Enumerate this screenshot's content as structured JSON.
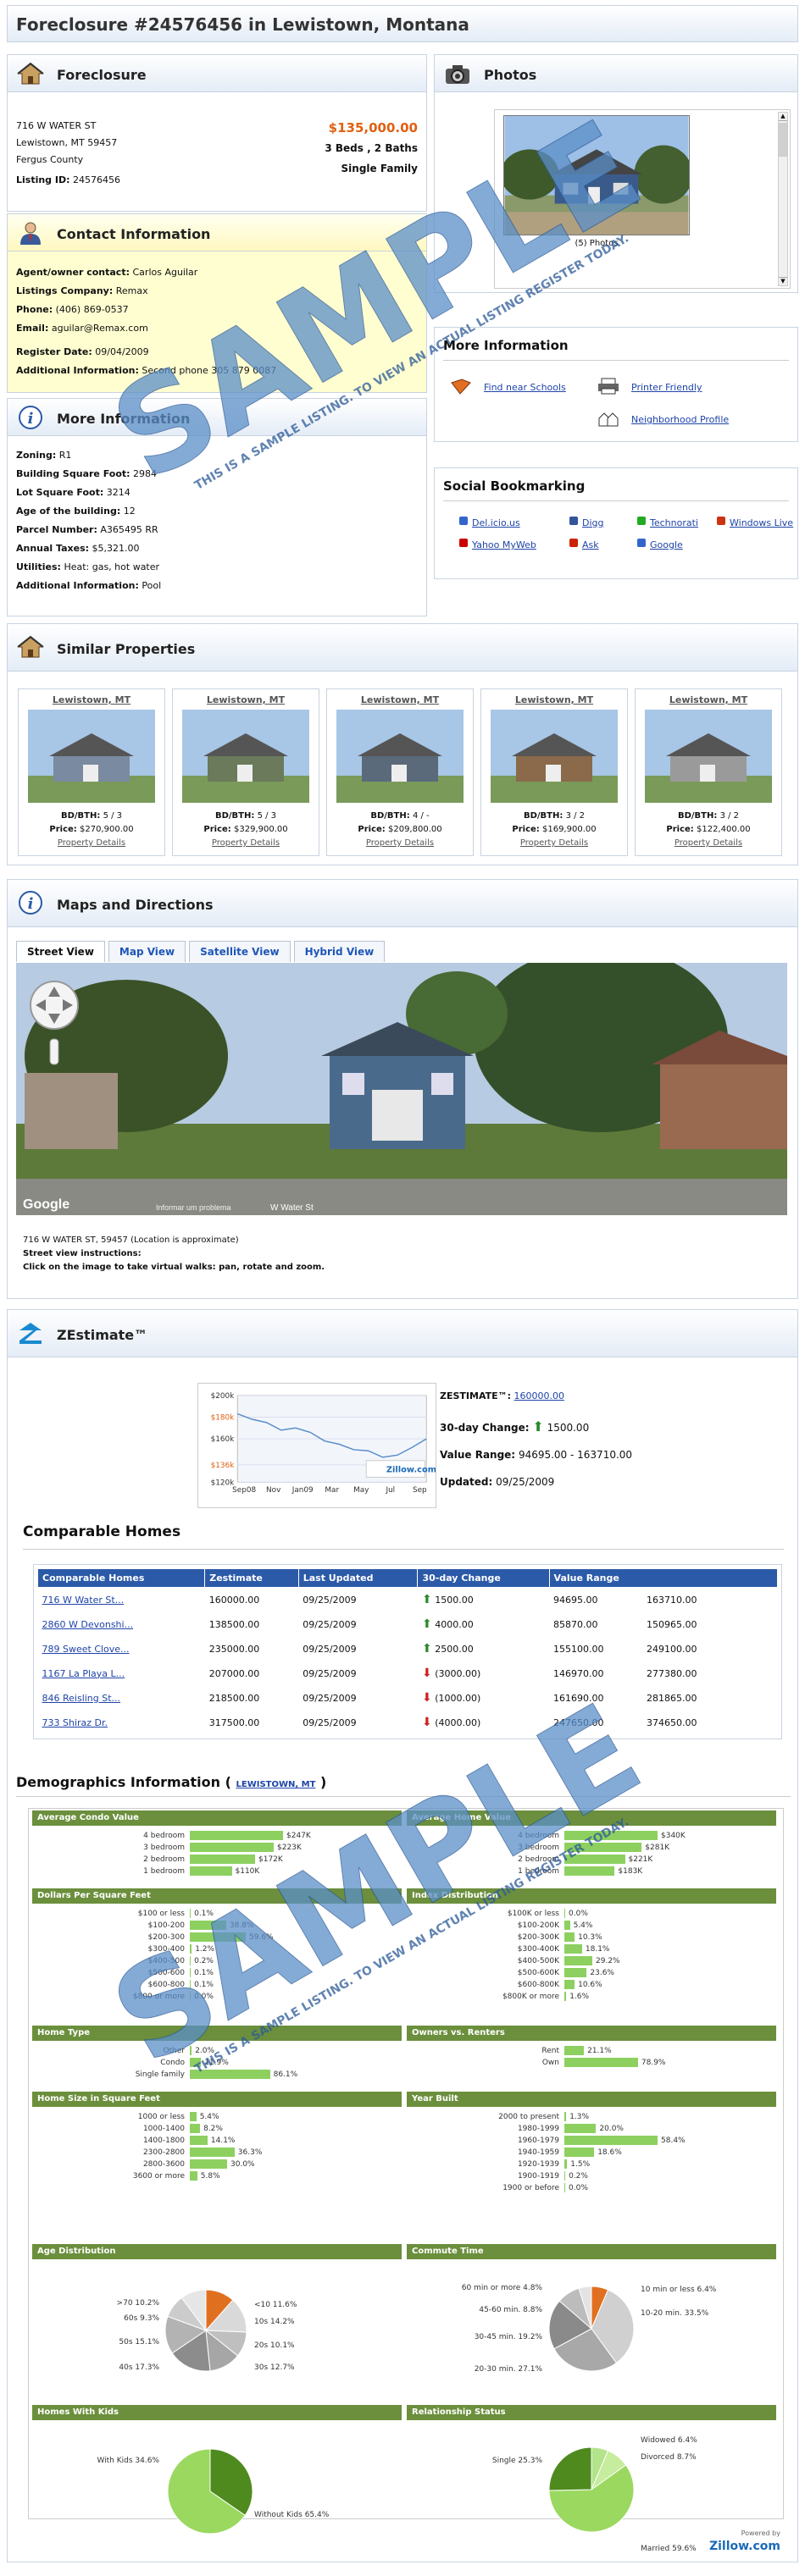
{
  "page_title": "Foreclosure #24576456 in Lewistown, Montana",
  "foreclosure": {
    "heading": "Foreclosure",
    "address1": "716 W WATER ST",
    "address2": "Lewistown, MT 59457",
    "county": "Fergus County",
    "listing_label": "Listing ID:",
    "listing_id": "24576456",
    "price": "$135,000.00",
    "beds": "3 Beds , 2 Baths",
    "type": "Single Family"
  },
  "contact": {
    "heading": "Contact Information",
    "rows": [
      {
        "k": "Agent/owner contact:",
        "v": "Carlos Aguilar"
      },
      {
        "k": "Listings Company:",
        "v": "Remax"
      },
      {
        "k": "Phone:",
        "v": "(406) 869-0537"
      },
      {
        "k": "Email:",
        "v": "aguilar@Remax.com"
      },
      {
        "k": "Register Date:",
        "v": "09/04/2009"
      },
      {
        "k": "Additional Information:",
        "v": "Second phone 305 879 0087"
      }
    ]
  },
  "more_info_left": {
    "heading": "More Information",
    "rows": [
      {
        "k": "Zoning:",
        "v": "R1"
      },
      {
        "k": "Building Square Foot:",
        "v": "2984"
      },
      {
        "k": "Lot Square Foot:",
        "v": "3214"
      },
      {
        "k": "Age of the building:",
        "v": "12"
      },
      {
        "k": "Parcel Number:",
        "v": "A365495 RR"
      },
      {
        "k": "Annual Taxes:",
        "v": "$5,321.00"
      },
      {
        "k": "Utilities:",
        "v": "Heat: gas, hot water"
      },
      {
        "k": "Additional Information:",
        "v": "Pool"
      }
    ]
  },
  "photos": {
    "heading": "Photos",
    "caption": "(5) Photos"
  },
  "more_info_right": {
    "heading": "More Information",
    "find_schools": "Find near Schools",
    "printer": "Printer Friendly",
    "neighborhood": "Neighborhood Profile"
  },
  "social": {
    "heading": "Social Bookmarking",
    "items": [
      "Del.icio.us",
      "Digg",
      "Technorati",
      "Windows Live",
      "Yahoo MyWeb",
      "Ask",
      "Google"
    ]
  },
  "similar": {
    "heading": "Similar Properties",
    "items": [
      {
        "city": "Lewistown, MT",
        "bdbth": "5 / 3",
        "price": "$270,900.00",
        "link": "Property Details"
      },
      {
        "city": "Lewistown, MT",
        "bdbth": "5 / 3",
        "price": "$329,900.00",
        "link": "Property Details"
      },
      {
        "city": "Lewistown, MT",
        "bdbth": "4 / -",
        "price": "$209,800.00",
        "link": "Property Details"
      },
      {
        "city": "Lewistown, MT",
        "bdbth": "3 / 2",
        "price": "$169,900.00",
        "link": "Property Details"
      },
      {
        "city": "Lewistown, MT",
        "bdbth": "3 / 2",
        "price": "$122,400.00",
        "link": "Property Details"
      }
    ],
    "bd_label": "BD/BTH:",
    "price_label": "Price:"
  },
  "maps": {
    "heading": "Maps and Directions",
    "tabs": [
      "Street View",
      "Map View",
      "Satellite View",
      "Hybrid View"
    ],
    "address": "716 W WATER ST, 59457 (Location is approximate)",
    "instr_title": "Street view instructions:",
    "instr": "Click on the image to take virtual walks: pan, rotate and zoom.",
    "google": "Google",
    "terms": "Informar um problema",
    "street": "W Water St"
  },
  "zestimate": {
    "heading": "ZEstimate™",
    "label": "ZESTIMATE™:",
    "value": "160000.00",
    "change_label": "30-day Change:",
    "change": "1500.00",
    "range_label": "Value Range:",
    "range": "94695.00 - 163710.00",
    "updated_label": "Updated:",
    "updated": "09/25/2009",
    "zillow": "Zillow.com"
  },
  "chart_data": {
    "type": "line",
    "x": [
      "Sep08",
      "Nov",
      "Jan09",
      "Mar",
      "May",
      "Jul",
      "Sep"
    ],
    "yticks": [
      "$200k",
      "$180k",
      "$160k",
      "$136k",
      "$120k"
    ],
    "ylim": [
      120000,
      200000
    ],
    "values": [
      183000,
      178000,
      175000,
      168000,
      170000,
      166000,
      158000,
      155000,
      150000,
      149000,
      143000,
      145000,
      152000,
      160000
    ]
  },
  "comparable": {
    "heading": "Comparable Homes",
    "cols": [
      "Comparable Homes",
      "Zestimate",
      "Last Updated",
      "30-day Change",
      "Value Range"
    ],
    "rows": [
      {
        "name": "716 W Water St...",
        "z": "160000.00",
        "u": "09/25/2009",
        "dir": "up",
        "c": "1500.00",
        "lo": "94695.00",
        "hi": "163710.00"
      },
      {
        "name": "2860 W Devonshi...",
        "z": "138500.00",
        "u": "09/25/2009",
        "dir": "up",
        "c": "4000.00",
        "lo": "85870.00",
        "hi": "150965.00"
      },
      {
        "name": "789 Sweet Clove...",
        "z": "235000.00",
        "u": "09/25/2009",
        "dir": "up",
        "c": "2500.00",
        "lo": "155100.00",
        "hi": "249100.00"
      },
      {
        "name": "1167 La Playa L...",
        "z": "207000.00",
        "u": "09/25/2009",
        "dir": "down",
        "c": "(3000.00)",
        "lo": "146970.00",
        "hi": "277380.00"
      },
      {
        "name": "846 Reisling St...",
        "z": "218500.00",
        "u": "09/25/2009",
        "dir": "down",
        "c": "(1000.00)",
        "lo": "161690.00",
        "hi": "281865.00"
      },
      {
        "name": "733 Shiraz Dr.",
        "z": "317500.00",
        "u": "09/25/2009",
        "dir": "down",
        "c": "(4000.00)",
        "lo": "247650.00",
        "hi": "374650.00"
      }
    ]
  },
  "demographics": {
    "heading": "Demographics Information (",
    "link": "LEWISTOWN, MT",
    "close": ")",
    "avg_condo": {
      "title": "Average Condo Value",
      "rows": [
        {
          "l": "4 bedroom",
          "v": "$247K",
          "f": 1.0
        },
        {
          "l": "3 bedroom",
          "v": "$223K",
          "f": 0.9
        },
        {
          "l": "2 bedroom",
          "v": "$172K",
          "f": 0.7
        },
        {
          "l": "1 bedroom",
          "v": "$110K",
          "f": 0.45
        }
      ]
    },
    "avg_home": {
      "title": "Average Home Value",
      "rows": [
        {
          "l": "4 bedroom",
          "v": "$340K",
          "f": 1.0
        },
        {
          "l": "3 bedroom",
          "v": "$281K",
          "f": 0.83
        },
        {
          "l": "2 bedroom",
          "v": "$221K",
          "f": 0.65
        },
        {
          "l": "1 bedroom",
          "v": "$183K",
          "f": 0.54
        }
      ]
    },
    "dpsf": {
      "title": "Dollars Per Square Feet",
      "rows": [
        {
          "l": "$100 or less",
          "v": "0.1%",
          "f": 0.01
        },
        {
          "l": "$100-200",
          "v": "38.8%",
          "f": 0.39
        },
        {
          "l": "$200-300",
          "v": "59.6%",
          "f": 0.6
        },
        {
          "l": "$300-400",
          "v": "1.2%",
          "f": 0.02
        },
        {
          "l": "$400-500",
          "v": "0.2%",
          "f": 0.01
        },
        {
          "l": "$500-600",
          "v": "0.1%",
          "f": 0.01
        },
        {
          "l": "$600-800",
          "v": "0.1%",
          "f": 0.01
        },
        {
          "l": "$800 or more",
          "v": "0.0%",
          "f": 0
        }
      ]
    },
    "index": {
      "title": "Index Distribution",
      "rows": [
        {
          "l": "$100K or less",
          "v": "0.0%",
          "f": 0
        },
        {
          "l": "$100-200K",
          "v": "5.4%",
          "f": 0.06
        },
        {
          "l": "$200-300K",
          "v": "10.3%",
          "f": 0.11
        },
        {
          "l": "$300-400K",
          "v": "18.1%",
          "f": 0.19
        },
        {
          "l": "$400-500K",
          "v": "29.2%",
          "f": 0.3
        },
        {
          "l": "$500-600K",
          "v": "23.6%",
          "f": 0.24
        },
        {
          "l": "$600-800K",
          "v": "10.6%",
          "f": 0.11
        },
        {
          "l": "$800K or more",
          "v": "1.6%",
          "f": 0.02
        }
      ]
    },
    "hometype": {
      "title": "Home Type",
      "rows": [
        {
          "l": "Other",
          "v": "2.0%",
          "f": 0.02
        },
        {
          "l": "Condo",
          "v": "11.9%",
          "f": 0.12
        },
        {
          "l": "Single family",
          "v": "86.1%",
          "f": 0.86
        }
      ]
    },
    "owners": {
      "title": "Owners vs. Renters",
      "rows": [
        {
          "l": "Rent",
          "v": "21.1%",
          "f": 0.21
        },
        {
          "l": "Own",
          "v": "78.9%",
          "f": 0.79
        }
      ]
    },
    "homesize": {
      "title": "Home Size in Square Feet",
      "rows": [
        {
          "l": "1000 or less",
          "v": "5.4%",
          "f": 0.07
        },
        {
          "l": "1000-1400",
          "v": "8.2%",
          "f": 0.11
        },
        {
          "l": "1400-1800",
          "v": "14.1%",
          "f": 0.19
        },
        {
          "l": "2300-2800",
          "v": "36.3%",
          "f": 0.48
        },
        {
          "l": "2800-3600",
          "v": "30.0%",
          "f": 0.4
        },
        {
          "l": "3600 or more",
          "v": "5.8%",
          "f": 0.08
        }
      ]
    },
    "yearbuilt": {
      "title": "Year Built",
      "rows": [
        {
          "l": "2000 to present",
          "v": "1.3%",
          "f": 0.02
        },
        {
          "l": "1980-1999",
          "v": "20.0%",
          "f": 0.34
        },
        {
          "l": "1960-1979",
          "v": "58.4%",
          "f": 1.0
        },
        {
          "l": "1940-1959",
          "v": "18.6%",
          "f": 0.32
        },
        {
          "l": "1920-1939",
          "v": "1.5%",
          "f": 0.03
        },
        {
          "l": "1900-1919",
          "v": "0.2%",
          "f": 0.01
        },
        {
          "l": "1900 or before",
          "v": "0.0%",
          "f": 0
        }
      ]
    },
    "age": {
      "title": "Age Distribution",
      "labels": [
        ">70 10.2%",
        "60s 9.3%",
        "50s 15.1%",
        "40s 17.3%",
        "<10 11.6%",
        "10s 14.2%",
        "20s 10.1%",
        "30s 12.7%"
      ],
      "slices": [
        11.6,
        14.2,
        10.1,
        12.7,
        17.3,
        15.1,
        9.3,
        10.2
      ],
      "colors": [
        "#e07020",
        "#d9d9d9",
        "#bfbfbf",
        "#a6a6a6",
        "#8c8c8c",
        "#b3b3b3",
        "#cccccc",
        "#e6e6e6"
      ]
    },
    "commute": {
      "title": "Commute Time",
      "labels": [
        "60 min or more 4.8%",
        "45-60 min. 8.8%",
        "30-45 min. 19.2%",
        "20-30 min. 27.1%",
        "10 min or less 6.4%",
        "10-20 min. 33.5%"
      ],
      "slices": [
        6.4,
        33.5,
        27.1,
        19.2,
        8.8,
        4.8
      ],
      "colors": [
        "#e07020",
        "#d0d0d0",
        "#a8a8a8",
        "#8a8a8a",
        "#bcbcbc",
        "#e3e3e3"
      ]
    },
    "kids": {
      "title": "Homes With Kids",
      "labels": [
        "With Kids 34.6%",
        "Without Kids 65.4%"
      ],
      "slices": [
        34.6,
        65.4
      ],
      "colors": [
        "#4e8a1e",
        "#9bd860"
      ]
    },
    "relationship": {
      "title": "Relationship Status",
      "labels": [
        "Single 25.3%",
        "Widowed 6.4%",
        "Divorced 8.7%",
        "Married 59.6%"
      ],
      "slices": [
        6.4,
        8.7,
        59.6,
        25.3
      ],
      "colors": [
        "#b3e38a",
        "#c6ec9e",
        "#9bd860",
        "#4e8a1e"
      ]
    }
  },
  "footer": {
    "powered": "Powered by",
    "zillow": "Zillow.com"
  },
  "watermark": {
    "word": "SAMPLE",
    "sub": "THIS IS A SAMPLE LISTING. TO VIEW AN ACTUAL LISTING REGISTER TODAY."
  }
}
